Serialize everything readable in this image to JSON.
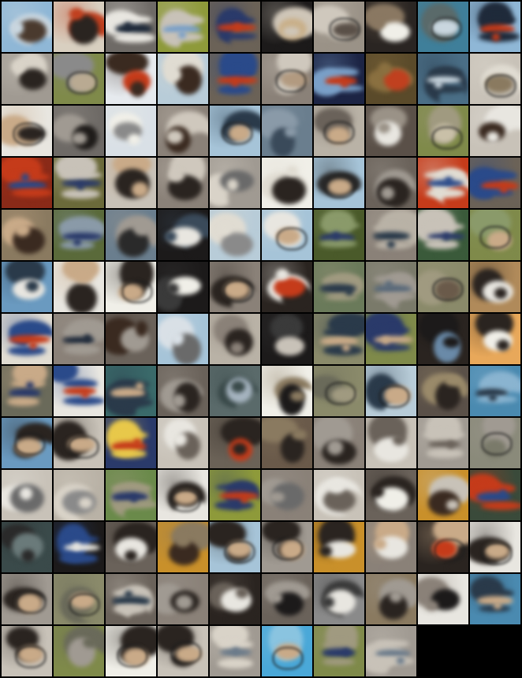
{
  "grid": {
    "columns": 10,
    "rows": 13,
    "filled_tiles": 128,
    "tiles": [
      {
        "palette": [
          "#8fb7d6",
          "#4a3a2e",
          "#c9d6df"
        ],
        "subject": "dark-blob"
      },
      {
        "palette": [
          "#d8cfc0",
          "#2a2420",
          "#c0401f"
        ],
        "subject": "dark-blob"
      },
      {
        "palette": [
          "#6e6a66",
          "#1f2a3a",
          "#e8e6e0"
        ],
        "subject": "striped-object"
      },
      {
        "palette": [
          "#8e9a3a",
          "#7aa0c8",
          "#c8c2b8"
        ],
        "subject": "striped-object"
      },
      {
        "palette": [
          "#6b6257",
          "#c53b1a",
          "#2a3a6a"
        ],
        "subject": "striped-object"
      },
      {
        "palette": [
          "#1c1a1a",
          "#c9b08a",
          "#cfc6b8"
        ],
        "subject": "dark-blob"
      },
      {
        "palette": [
          "#9a9287",
          "#5a5048",
          "#cfc8bd"
        ],
        "subject": "tan-blob"
      },
      {
        "palette": [
          "#2a2522",
          "#f0efe8",
          "#8a7862"
        ],
        "subject": "white-blob"
      },
      {
        "palette": [
          "#3f7f9a",
          "#c9d6df",
          "#5a6a6a"
        ],
        "subject": "tan-blob"
      },
      {
        "palette": [
          "#8fb7d6",
          "#c53b1a",
          "#1f2a3a"
        ],
        "subject": "striped-object"
      },
      {
        "palette": [
          "#a09a92",
          "#2a2420",
          "#d9d3c8"
        ],
        "subject": "dark-blob"
      },
      {
        "palette": [
          "#7f8a4a",
          "#b9aa92",
          "#8a8a8a"
        ],
        "subject": "tan-blob"
      },
      {
        "palette": [
          "#e6eaee",
          "#c53b1a",
          "#3a2a20"
        ],
        "subject": "dark-blob"
      },
      {
        "palette": [
          "#b8ccd8",
          "#3a2a20",
          "#e0dcd2"
        ],
        "subject": "dark-blob"
      },
      {
        "palette": [
          "#6b6257",
          "#c53b1a",
          "#2a4a8a"
        ],
        "subject": "striped-object"
      },
      {
        "palette": [
          "#8a8178",
          "#b29a80",
          "#cfc8bd"
        ],
        "subject": "tan-blob"
      },
      {
        "palette": [
          "#1c2444",
          "#c53b1a",
          "#7aa0c8"
        ],
        "subject": "striped-object"
      },
      {
        "palette": [
          "#5a4a2a",
          "#c0401f",
          "#8a7040"
        ],
        "subject": "dark-blob"
      },
      {
        "palette": [
          "#4a6e86",
          "#c9d6df",
          "#2a3a4a"
        ],
        "subject": "striped-object"
      },
      {
        "palette": [
          "#c8c2b8",
          "#8a7a60",
          "#e0dcd2"
        ],
        "subject": "tan-blob"
      },
      {
        "palette": [
          "#e8e6e0",
          "#2a2420",
          "#c9aa88"
        ],
        "subject": "tan-blob"
      },
      {
        "palette": [
          "#6e6a66",
          "#1f1c1a",
          "#a09a92"
        ],
        "subject": "dark-blob"
      },
      {
        "palette": [
          "#d9e0e6",
          "#8a8a8a",
          "#f0efe8"
        ],
        "subject": "white-blob"
      },
      {
        "palette": [
          "#8a8178",
          "#3a2a20",
          "#cfc8bd"
        ],
        "subject": "dark-blob"
      },
      {
        "palette": [
          "#a6c4d8",
          "#c9aa88",
          "#2a3a4a"
        ],
        "subject": "tan-blob"
      },
      {
        "palette": [
          "#6a7e8e",
          "#3a4a5a",
          "#8a9aa8"
        ],
        "subject": "dark-blob"
      },
      {
        "palette": [
          "#b9b2a6",
          "#c9aa88",
          "#6a625a"
        ],
        "subject": "tan-blob"
      },
      {
        "palette": [
          "#5a5048",
          "#e8e6e0",
          "#9a9287"
        ],
        "subject": "white-blob"
      },
      {
        "palette": [
          "#7f8a4a",
          "#c9c0a8",
          "#a09a80"
        ],
        "subject": "tan-blob"
      },
      {
        "palette": [
          "#c8c2b8",
          "#3a2a20",
          "#e8e6e0"
        ],
        "subject": "white-blob"
      },
      {
        "palette": [
          "#8a2a18",
          "#2a4a8a",
          "#c53b1a"
        ],
        "subject": "striped-object"
      },
      {
        "palette": [
          "#6b6a3a",
          "#2a3a6a",
          "#c8c2b8"
        ],
        "subject": "striped-object"
      },
      {
        "palette": [
          "#c8c2b8",
          "#2a2420",
          "#c9aa88"
        ],
        "subject": "dark-blob"
      },
      {
        "palette": [
          "#8a8178",
          "#2a2420",
          "#cfc8bd"
        ],
        "subject": "dark-blob"
      },
      {
        "palette": [
          "#a09a92",
          "#6a6a6a",
          "#d9d3c8"
        ],
        "subject": "dark-blob"
      },
      {
        "palette": [
          "#f0efe8",
          "#2a2420",
          "#e0dcd2"
        ],
        "subject": "dark-blob"
      },
      {
        "palette": [
          "#a6c4d8",
          "#c9aa88",
          "#2a2a2a"
        ],
        "subject": "tan-blob"
      },
      {
        "palette": [
          "#6a625a",
          "#2a2420",
          "#a09a92"
        ],
        "subject": "dark-blob"
      },
      {
        "palette": [
          "#c53b1a",
          "#2a4a8a",
          "#e0dcd2"
        ],
        "subject": "striped-object"
      },
      {
        "palette": [
          "#6b6257",
          "#c53b1a",
          "#2a4a8a"
        ],
        "subject": "striped-object"
      },
      {
        "palette": [
          "#8a7a60",
          "#3a2a20",
          "#c9aa88"
        ],
        "subject": "dark-blob"
      },
      {
        "palette": [
          "#5a6a3a",
          "#2a3a6a",
          "#8a9aa8"
        ],
        "subject": "striped-object"
      },
      {
        "palette": [
          "#6a7e8e",
          "#2a2a2a",
          "#a09a92"
        ],
        "subject": "dark-blob"
      },
      {
        "palette": [
          "#1c1a1a",
          "#e8e6e0",
          "#3a4a5a"
        ],
        "subject": "white-blob"
      },
      {
        "palette": [
          "#b8ccd8",
          "#8a8a8a",
          "#e0dcd2"
        ],
        "subject": "white-blob"
      },
      {
        "palette": [
          "#a6c4d8",
          "#c9aa88",
          "#e8e6e0"
        ],
        "subject": "tan-blob"
      },
      {
        "palette": [
          "#4a5a2a",
          "#2a3a6a",
          "#8a9a6a"
        ],
        "subject": "striped-object"
      },
      {
        "palette": [
          "#8a8178",
          "#2a3a4a",
          "#b9b2a6"
        ],
        "subject": "striped-object"
      },
      {
        "palette": [
          "#3a5a3a",
          "#2a3a6a",
          "#c8c2b8"
        ],
        "subject": "striped-object"
      },
      {
        "palette": [
          "#7f8a4a",
          "#c9aa88",
          "#8a9a6a"
        ],
        "subject": "tan-blob"
      },
      {
        "palette": [
          "#6a9ac0",
          "#e8e6e0",
          "#2a3a4a"
        ],
        "subject": "white-blob"
      },
      {
        "palette": [
          "#e8e6e0",
          "#2a2420",
          "#c9aa88"
        ],
        "subject": "dark-blob"
      },
      {
        "palette": [
          "#f0efe8",
          "#c9aa88",
          "#2a2420"
        ],
        "subject": "tan-blob"
      },
      {
        "palette": [
          "#1c1a1a",
          "#f0efe8",
          "#3a3a3a"
        ],
        "subject": "white-blob"
      },
      {
        "palette": [
          "#8a8178",
          "#c9aa88",
          "#2a2420"
        ],
        "subject": "tan-blob"
      },
      {
        "palette": [
          "#2a2420",
          "#c53b1a",
          "#e8e6e0"
        ],
        "subject": "white-blob"
      },
      {
        "palette": [
          "#6a7a5a",
          "#2a3a4a",
          "#a09a80"
        ],
        "subject": "striped-object"
      },
      {
        "palette": [
          "#7a7a6a",
          "#5a6a7a",
          "#a09a92"
        ],
        "subject": "striped-object"
      },
      {
        "palette": [
          "#8a8a6a",
          "#6a5a4a",
          "#a09a80"
        ],
        "subject": "tan-blob"
      },
      {
        "palette": [
          "#b08a5a",
          "#e8e6e0",
          "#2a2420"
        ],
        "subject": "white-blob"
      },
      {
        "palette": [
          "#e0dcd2",
          "#c53b1a",
          "#2a4a8a"
        ],
        "subject": "striped-object"
      },
      {
        "palette": [
          "#8a8178",
          "#1f2a3a",
          "#a09a92"
        ],
        "subject": "striped-object"
      },
      {
        "palette": [
          "#6a625a",
          "#a09a92",
          "#3a2a20"
        ],
        "subject": "dark-blob"
      },
      {
        "palette": [
          "#a6c4d8",
          "#6a6a6a",
          "#d9e0e6"
        ],
        "subject": "dark-blob"
      },
      {
        "palette": [
          "#b9b2a6",
          "#2a2420",
          "#8a8178"
        ],
        "subject": "dark-blob"
      },
      {
        "palette": [
          "#1c1a1a",
          "#c8c2b8",
          "#3a3a3a"
        ],
        "subject": "white-blob"
      },
      {
        "palette": [
          "#8a8a6a",
          "#c9aa88",
          "#2a3a4a"
        ],
        "subject": "striped-object"
      },
      {
        "palette": [
          "#7f8a4a",
          "#c9aa88",
          "#2a3a6a"
        ],
        "subject": "striped-object"
      },
      {
        "palette": [
          "#2a2420",
          "#6a8aa8",
          "#1c1a1a"
        ],
        "subject": "dark-blob"
      },
      {
        "palette": [
          "#e8a85a",
          "#f0efe8",
          "#2a2420"
        ],
        "subject": "white-blob"
      },
      {
        "palette": [
          "#6a6a5a",
          "#2a3a6a",
          "#c9aa88"
        ],
        "subject": "striped-object"
      },
      {
        "palette": [
          "#e8e6e0",
          "#c53b1a",
          "#2a4a8a"
        ],
        "subject": "striped-object"
      },
      {
        "palette": [
          "#3a6a6a",
          "#c9aa88",
          "#2a3a4a"
        ],
        "subject": "striped-object"
      },
      {
        "palette": [
          "#6a625a",
          "#2a2420",
          "#a09a92"
        ],
        "subject": "dark-blob"
      },
      {
        "palette": [
          "#5a6a6a",
          "#a6b4c0",
          "#3a4a4a"
        ],
        "subject": "dark-blob"
      },
      {
        "palette": [
          "#f0efe8",
          "#1c1a1a",
          "#8a7a60"
        ],
        "subject": "dark-blob"
      },
      {
        "palette": [
          "#8a8a6a",
          "#a09a80",
          "#6a6a5a"
        ],
        "subject": "tan-blob"
      },
      {
        "palette": [
          "#b8ccd8",
          "#c9aa88",
          "#2a3a4a"
        ],
        "subject": "tan-blob"
      },
      {
        "palette": [
          "#5a5048",
          "#2a2420",
          "#9a8a6a"
        ],
        "subject": "dark-blob"
      },
      {
        "palette": [
          "#4a8ab0",
          "#2a3a4a",
          "#8ab4d0"
        ],
        "subject": "striped-object"
      },
      {
        "palette": [
          "#6a9ac0",
          "#c9aa88",
          "#2a2420"
        ],
        "subject": "tan-blob"
      },
      {
        "palette": [
          "#c8c2b8",
          "#c9aa88",
          "#2a2420"
        ],
        "subject": "tan-blob"
      },
      {
        "palette": [
          "#2a3a6a",
          "#c53b1a",
          "#e8c84a"
        ],
        "subject": "striped-object"
      },
      {
        "palette": [
          "#c8c2b8",
          "#6a625a",
          "#e8e6e0"
        ],
        "subject": "dark-blob"
      },
      {
        "palette": [
          "#6b6257",
          "#c53b1a",
          "#2a2420"
        ],
        "subject": "dark-blob"
      },
      {
        "palette": [
          "#6a5a4a",
          "#2a2420",
          "#8a7a60"
        ],
        "subject": "dark-blob"
      },
      {
        "palette": [
          "#8a8178",
          "#2a2420",
          "#a09a92"
        ],
        "subject": "dark-blob"
      },
      {
        "palette": [
          "#c8c2b8",
          "#e8e6e0",
          "#6a625a"
        ],
        "subject": "white-blob"
      },
      {
        "palette": [
          "#a09a92",
          "#6a625a",
          "#c8c2b8"
        ],
        "subject": "striped-object"
      },
      {
        "palette": [
          "#8a8a7a",
          "#7a7a6a",
          "#a09a92"
        ],
        "subject": "tan-blob"
      },
      {
        "palette": [
          "#c8c2b8",
          "#6a6a6a",
          "#e8e6e0"
        ],
        "subject": "dark-blob"
      },
      {
        "palette": [
          "#b9b2a6",
          "#8a8a8a",
          "#d9d3c8"
        ],
        "subject": "dark-blob"
      },
      {
        "palette": [
          "#6a8a4a",
          "#2a3a6a",
          "#a09a80"
        ],
        "subject": "striped-object"
      },
      {
        "palette": [
          "#e8e6e0",
          "#c9aa88",
          "#2a2420"
        ],
        "subject": "tan-blob"
      },
      {
        "palette": [
          "#8e9a3a",
          "#c53b1a",
          "#2a3a6a"
        ],
        "subject": "striped-object"
      },
      {
        "palette": [
          "#8a8178",
          "#6a6a6a",
          "#a09a92"
        ],
        "subject": "dark-blob"
      },
      {
        "palette": [
          "#c8c2b8",
          "#6a625a",
          "#e8e6e0"
        ],
        "subject": "dark-blob"
      },
      {
        "palette": [
          "#6a625a",
          "#f0efe8",
          "#2a2420"
        ],
        "subject": "white-blob"
      },
      {
        "palette": [
          "#c9902a",
          "#3a2a20",
          "#c8c2b8"
        ],
        "subject": "dark-blob"
      },
      {
        "palette": [
          "#3a4a3a",
          "#2a4a8a",
          "#c53b1a"
        ],
        "subject": "striped-object"
      },
      {
        "palette": [
          "#3a4a4a",
          "#6a7a7a",
          "#2a2a2a"
        ],
        "subject": "dark-blob"
      },
      {
        "palette": [
          "#1c1a1a",
          "#e8e6e0",
          "#2a4a8a"
        ],
        "subject": "striped-object"
      },
      {
        "palette": [
          "#6a625a",
          "#e8e6e0",
          "#2a2420"
        ],
        "subject": "white-blob"
      },
      {
        "palette": [
          "#c9902a",
          "#3a2a20",
          "#8a7a60"
        ],
        "subject": "dark-blob"
      },
      {
        "palette": [
          "#a6c4d8",
          "#c9aa88",
          "#2a2420"
        ],
        "subject": "tan-blob"
      },
      {
        "palette": [
          "#a09a92",
          "#c9aa88",
          "#2a2420"
        ],
        "subject": "tan-blob"
      },
      {
        "palette": [
          "#c9902a",
          "#e8e6e0",
          "#2a2420"
        ],
        "subject": "white-blob"
      },
      {
        "palette": [
          "#8a8178",
          "#e8e6e0",
          "#c9aa88"
        ],
        "subject": "white-blob"
      },
      {
        "palette": [
          "#2a2420",
          "#c53b1a",
          "#c9aa88"
        ],
        "subject": "tan-blob"
      },
      {
        "palette": [
          "#e8e6e0",
          "#c9aa88",
          "#2a2420"
        ],
        "subject": "tan-blob"
      },
      {
        "palette": [
          "#a09a92",
          "#c9aa88",
          "#2a2420"
        ],
        "subject": "tan-blob"
      },
      {
        "palette": [
          "#8a8a6a",
          "#c9aa88",
          "#6a6a5a"
        ],
        "subject": "tan-blob"
      },
      {
        "palette": [
          "#6a625a",
          "#2a3a4a",
          "#c8c2b8"
        ],
        "subject": "striped-object"
      },
      {
        "palette": [
          "#8a8178",
          "#2a2420",
          "#a09a92"
        ],
        "subject": "dark-blob"
      },
      {
        "palette": [
          "#2a2420",
          "#e8e6e0",
          "#6a625a"
        ],
        "subject": "white-blob"
      },
      {
        "palette": [
          "#6a625a",
          "#1c1a1a",
          "#a09a92"
        ],
        "subject": "dark-blob"
      },
      {
        "palette": [
          "#8a8a8a",
          "#e8e6e0",
          "#3a3a3a"
        ],
        "subject": "white-blob"
      },
      {
        "palette": [
          "#8a7a60",
          "#2a2420",
          "#a09a92"
        ],
        "subject": "dark-blob"
      },
      {
        "palette": [
          "#e8e6e0",
          "#1c1a1a",
          "#8a8178"
        ],
        "subject": "dark-blob"
      },
      {
        "palette": [
          "#4a8ab0",
          "#c9aa88",
          "#2a3a4a"
        ],
        "subject": "striped-object"
      },
      {
        "palette": [
          "#c8c2b8",
          "#c9aa88",
          "#2a2420"
        ],
        "subject": "tan-blob"
      },
      {
        "palette": [
          "#7f8a4a",
          "#a09a92",
          "#6a6a5a"
        ],
        "subject": "dark-blob"
      },
      {
        "palette": [
          "#f0efe8",
          "#c9aa88",
          "#2a2420"
        ],
        "subject": "tan-blob"
      },
      {
        "palette": [
          "#c8c2b8",
          "#c9aa88",
          "#2a2420"
        ],
        "subject": "tan-blob"
      },
      {
        "palette": [
          "#a09a92",
          "#6a7a8a",
          "#d9d3c8"
        ],
        "subject": "striped-object"
      },
      {
        "palette": [
          "#4aa8d8",
          "#c9aa88",
          "#8ac4e0"
        ],
        "subject": "tan-blob"
      },
      {
        "palette": [
          "#7f8a4a",
          "#2a3a6a",
          "#a09a80"
        ],
        "subject": "striped-object"
      },
      {
        "palette": [
          "#a09a92",
          "#6a7a8a",
          "#c8c2b8"
        ],
        "subject": "striped-object"
      }
    ]
  }
}
